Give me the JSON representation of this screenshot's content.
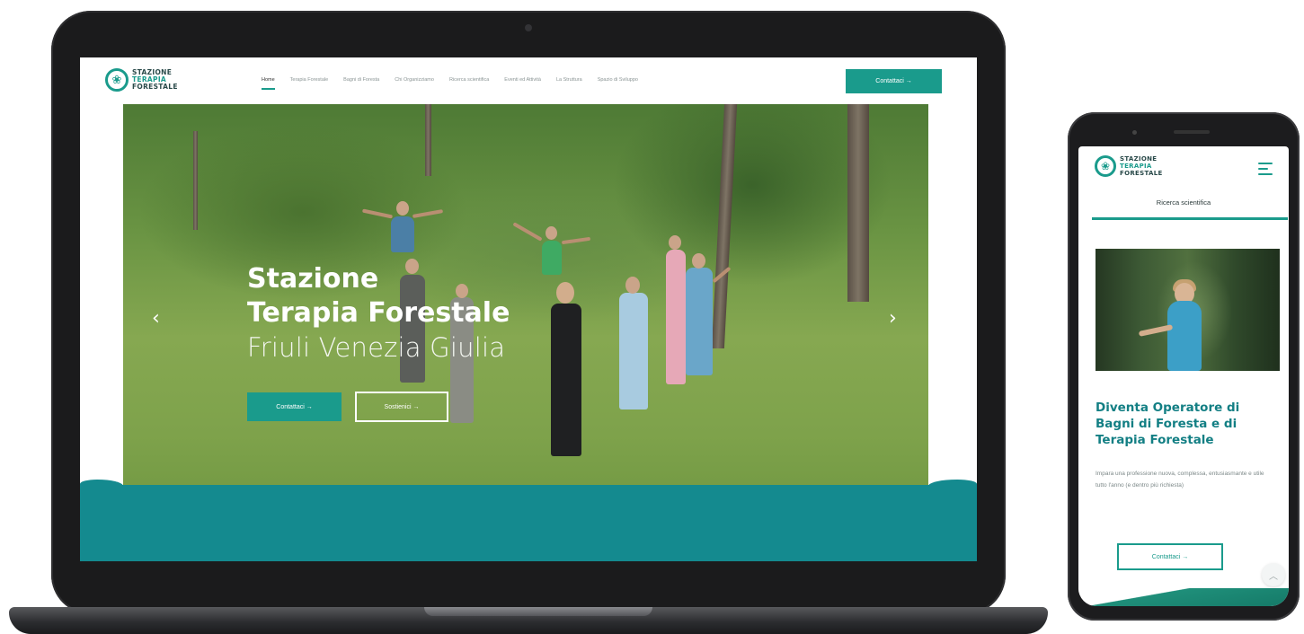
{
  "logo": {
    "line1": "STAZIONE",
    "line2": "TERAPIA",
    "line3": "FORESTALE",
    "icon": "leaf-circle-icon"
  },
  "desktop": {
    "nav": [
      "Home",
      "Terapia Forestale",
      "Bagni di Foresta",
      "Chi Organizziamo",
      "Ricerca scientifica",
      "Eventi ed Attività",
      "La Struttura",
      "Spazio di Sviluppo"
    ],
    "header_cta": "Contattaci →",
    "hero": {
      "title_line1": "Stazione",
      "title_line2": "Terapia Forestale",
      "title_line3": "Friuli Venezia Giulia",
      "primary_button": "Contattaci →",
      "secondary_button": "Sostienici →",
      "prev_arrow": "‹",
      "next_arrow": "›"
    }
  },
  "mobile": {
    "section_title": "Ricerca scientifica",
    "heading": "Diventa Operatore di Bagni di Foresta e di Terapia Forestale",
    "text": "Impara una professione nuova, complessa, entusiasmante e utile tutto l'anno (e dentro più richiesta)",
    "button": "Contattaci →",
    "scroll_top_icon": "chevron-up-icon",
    "menu_icon": "hamburger-icon"
  },
  "colors": {
    "accent": "#1a9b8c",
    "band": "#148a8f",
    "heading": "#137f84"
  }
}
